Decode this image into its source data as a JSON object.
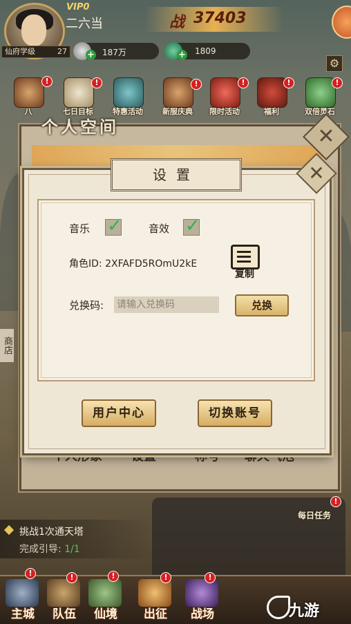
{
  "header": {
    "vip_label": "VIP0",
    "player_name": "二六当",
    "realm_label": "仙府学级",
    "realm_level": "27",
    "power_icon": "战",
    "power_value": "37403",
    "silver": "187万",
    "jade": "1809"
  },
  "activities": [
    {
      "label": "八",
      "icon": "banner-icon"
    },
    {
      "label": "七日目标",
      "icon": "seven-day-icon"
    },
    {
      "label": "特惠活动",
      "icon": "treasure-chest-icon"
    },
    {
      "label": "新服庆典",
      "icon": "celebration-icon"
    },
    {
      "label": "限时活动",
      "icon": "gift-box-icon"
    },
    {
      "label": "福利",
      "icon": "pouch-icon"
    },
    {
      "label": "双倍灵石",
      "icon": "spirit-stone-icon"
    }
  ],
  "back_panel": {
    "title": "个人空间",
    "menu": [
      "个人形象",
      "设置",
      "称号",
      "聊天气泡"
    ]
  },
  "settings": {
    "title": "设置",
    "music_label": "音乐",
    "sfx_label": "音效",
    "music_on": true,
    "sfx_on": true,
    "role_id_label": "角色ID:",
    "role_id_value": "2XFAFD5ROmU2kE",
    "copy_label": "复制",
    "redeem_label": "兑换码:",
    "redeem_placeholder": "请输入兑换码",
    "redeem_button": "兑换",
    "user_center_button": "用户中心",
    "switch_account_button": "切换账号"
  },
  "side_tab": "商店",
  "quest": {
    "title": "挑战1次通天塔",
    "progress_label": "完成引导:",
    "progress_value": "1/1"
  },
  "daily_task": "每日任务",
  "bottom_nav": [
    "主城",
    "队伍",
    "仙境",
    "出征",
    "战场"
  ],
  "watermark": "九游"
}
